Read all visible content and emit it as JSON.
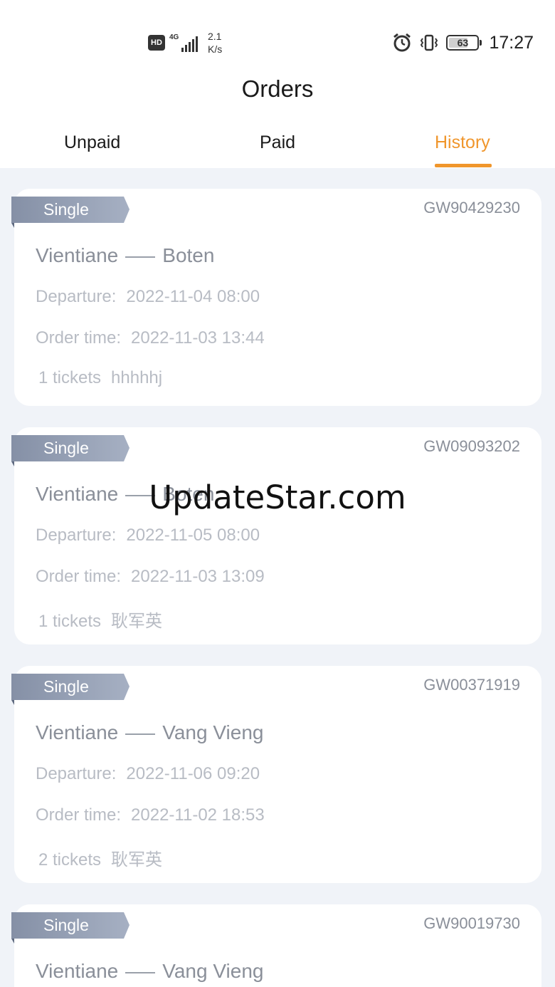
{
  "status_bar": {
    "hd": "HD",
    "network": "4G",
    "speed_value": "2.1",
    "speed_unit": "K/s",
    "battery": "63",
    "time": "17:27"
  },
  "header": {
    "title": "Orders"
  },
  "tabs": [
    {
      "label": "Unpaid",
      "active": false
    },
    {
      "label": "Paid",
      "active": false
    },
    {
      "label": "History",
      "active": true
    }
  ],
  "colors": {
    "accent": "#f0962c",
    "background": "#f0f3f8",
    "tag": "#8f98ab"
  },
  "orders": [
    {
      "type": "Single",
      "order_no": "GW90429230",
      "from": "Vientiane",
      "to": "Boten",
      "departure_label": "Departure:",
      "departure": "2022-11-04 08:00",
      "order_time_label": "Order time:",
      "order_time": "2022-11-03 13:44",
      "tickets": "1 tickets",
      "passenger": "hhhhhj"
    },
    {
      "type": "Single",
      "order_no": "GW09093202",
      "from": "Vientiane",
      "to": "Boten",
      "departure_label": "Departure:",
      "departure": "2022-11-05 08:00",
      "order_time_label": "Order time:",
      "order_time": "2022-11-03 13:09",
      "tickets": "1 tickets",
      "passenger": "耿军英"
    },
    {
      "type": "Single",
      "order_no": "GW00371919",
      "from": "Vientiane",
      "to": "Vang Vieng",
      "departure_label": "Departure:",
      "departure": "2022-11-06 09:20",
      "order_time_label": "Order time:",
      "order_time": "2022-11-02 18:53",
      "tickets": "2 tickets",
      "passenger": "耿军英"
    },
    {
      "type": "Single",
      "order_no": "GW90019730",
      "from": "Vientiane",
      "to": "Vang Vieng"
    }
  ],
  "watermark": "UpdateStar.com"
}
